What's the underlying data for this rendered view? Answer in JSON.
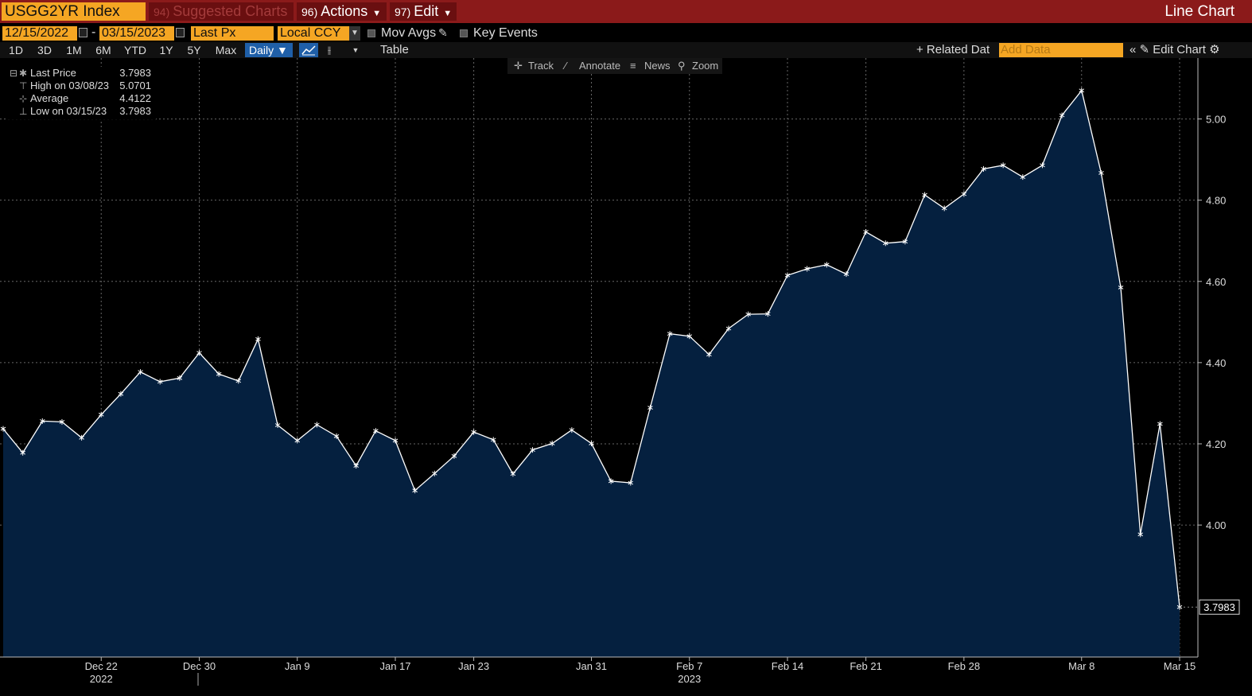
{
  "header": {
    "ticker": "USGG2YR Index",
    "suggested": {
      "num": "94)",
      "label": "Suggested Charts"
    },
    "actions": {
      "num": "96)",
      "label": "Actions"
    },
    "edit": {
      "num": "97)",
      "label": "Edit"
    },
    "chart_type_title": "Line Chart"
  },
  "controls": {
    "start_date": "12/15/2022",
    "end_date": "03/15/2023",
    "date_separator": "-",
    "field": "Last Px",
    "currency": "Local CCY",
    "mov_avgs": "Mov Avgs",
    "key_events": "Key Events",
    "periods": [
      "1D",
      "3D",
      "1M",
      "6M",
      "YTD",
      "1Y",
      "5Y",
      "Max"
    ],
    "frequency": "Daily",
    "table_label": "Table",
    "related_data": "+ Related Dat",
    "add_data_placeholder": "Add Data",
    "edit_chart": "Edit Chart"
  },
  "chart_tools": {
    "track": "Track",
    "annotate": "Annotate",
    "news": "News",
    "zoom": "Zoom"
  },
  "legend": {
    "last_label": "Last Price",
    "last_value": "3.7983",
    "high_label": "High on 03/08/23",
    "high_value": "5.0701",
    "avg_label": "Average",
    "avg_value": "4.4122",
    "low_label": "Low on 03/15/23",
    "low_value": "3.7983"
  },
  "colors": {
    "line": "#ffffff",
    "fill": "#05203f",
    "grid": "#555555",
    "topbar": "#8b1a1a",
    "accent": "#f5a623"
  },
  "chart_data": {
    "type": "area",
    "title": "",
    "xlabel": "",
    "ylabel": "",
    "ylim": [
      3.675,
      5.15
    ],
    "y_ticks": [
      "4.00",
      "4.20",
      "4.40",
      "4.60",
      "4.80",
      "5.00"
    ],
    "x_ticks": [
      {
        "index": 5,
        "label": "Dec 22",
        "sub": "2022"
      },
      {
        "index": 10,
        "label": "Dec 30"
      },
      {
        "index": 15,
        "label": "Jan 9"
      },
      {
        "index": 20,
        "label": "Jan 17"
      },
      {
        "index": 24,
        "label": "Jan 23"
      },
      {
        "index": 30,
        "label": "Jan 31"
      },
      {
        "index": 35,
        "label": "Feb 7",
        "sub": "2023"
      },
      {
        "index": 40,
        "label": "Feb 14"
      },
      {
        "index": 44,
        "label": "Feb 21"
      },
      {
        "index": 49,
        "label": "Feb 28"
      },
      {
        "index": 55,
        "label": "Mar 8"
      },
      {
        "index": 60,
        "label": "Mar 15"
      }
    ],
    "last_value_label": "3.7983",
    "series": [
      {
        "values": [
          4.237,
          4.178,
          4.256,
          4.254,
          4.215,
          4.272,
          4.323,
          4.377,
          4.353,
          4.362,
          4.424,
          4.372,
          4.355,
          4.458,
          4.246,
          4.208,
          4.247,
          4.219,
          4.146,
          4.232,
          4.208,
          4.085,
          4.127,
          4.17,
          4.229,
          4.21,
          4.126,
          4.185,
          4.201,
          4.234,
          4.201,
          4.108,
          4.104,
          4.289,
          4.471,
          4.465,
          4.42,
          4.484,
          4.519,
          4.52,
          4.615,
          4.631,
          4.641,
          4.618,
          4.722,
          4.694,
          4.698,
          4.813,
          4.78,
          4.815,
          4.877,
          4.886,
          4.857,
          4.886,
          5.009,
          5.07,
          4.867,
          4.585,
          3.977,
          4.249,
          3.798
        ]
      }
    ]
  }
}
